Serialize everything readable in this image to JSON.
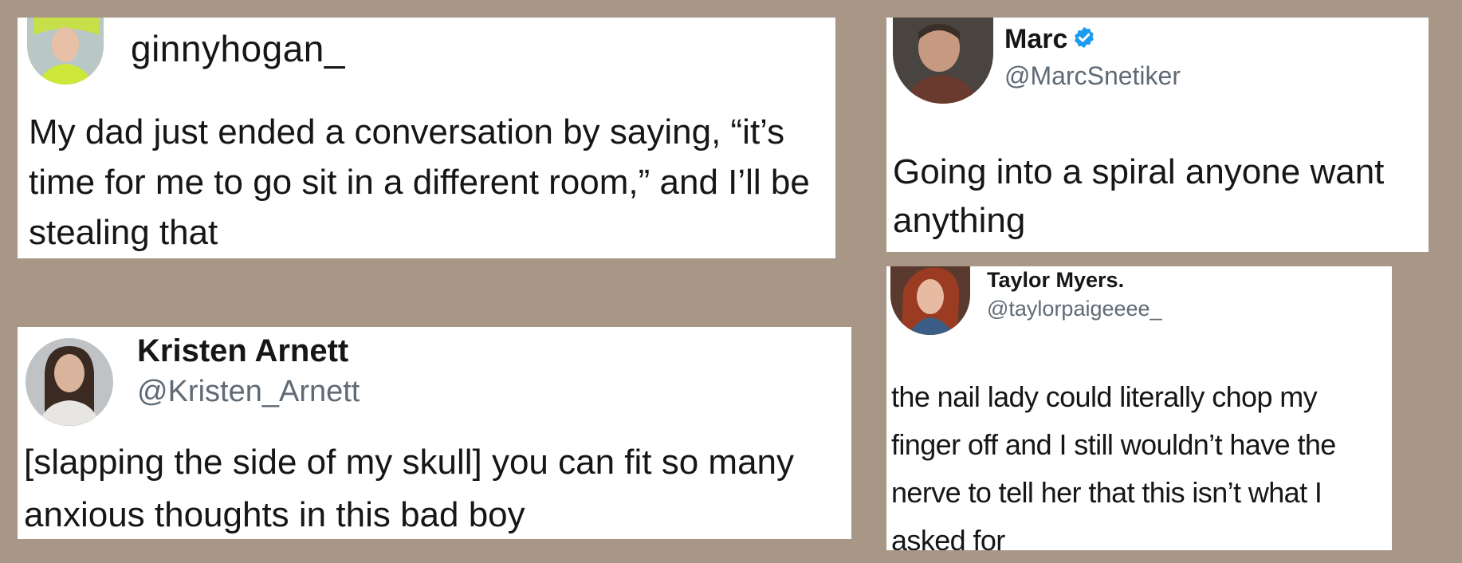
{
  "tweets": [
    {
      "name": "ginnyhogan_",
      "handle": "",
      "avatar_icon": "user-avatar-icon",
      "text": "My dad just ended a conversation by saying, “it’s time for me to go sit in a different room,” and I’ll be stealing that"
    },
    {
      "name": "Marc",
      "handle": "@MarcSnetiker",
      "verified": true,
      "verified_icon": "verified-badge-icon",
      "avatar_icon": "user-avatar-icon",
      "text": "Going into a spiral anyone want anything"
    },
    {
      "name": "Kristen Arnett",
      "handle": "@Kristen_Arnett",
      "avatar_icon": "user-avatar-icon",
      "text": "[slapping the side of my skull] you can fit so many anxious thoughts in this bad boy"
    },
    {
      "name": "Taylor Myers.",
      "handle": "@taylorpaigeeee_",
      "avatar_icon": "user-avatar-icon",
      "text": "the nail lady could literally chop my finger off and I still wouldn’t have the nerve to tell her that this isn’t what I asked for"
    }
  ],
  "colors": {
    "background": "#a89786",
    "card": "#ffffff",
    "handle": "#5f6a75",
    "verified": "#1d9bf0"
  }
}
